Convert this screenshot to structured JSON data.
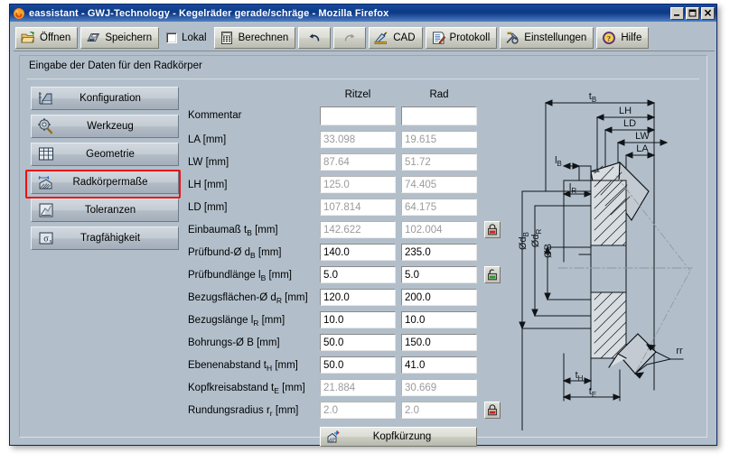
{
  "window": {
    "title": "eassistant - GWJ-Technology - Kegelräder gerade/schräge - Mozilla Firefox",
    "app_icon": "firefox-icon",
    "minimize": "_",
    "maximize": "❐",
    "close": "✕"
  },
  "toolbar": {
    "items": [
      {
        "label": "Öffnen",
        "icon": "open-folder-icon",
        "disabled": false
      },
      {
        "label": "Speichern",
        "icon": "floppy-disk-icon",
        "disabled": false
      },
      {
        "label": "Berechnen",
        "icon": "calculator-icon",
        "disabled": false
      },
      {
        "label": "",
        "icon": "undo-arrow-icon",
        "disabled": false
      },
      {
        "label": "",
        "icon": "redo-arrow-icon",
        "disabled": true
      },
      {
        "label": "CAD",
        "icon": "cad-ruler-icon",
        "disabled": false
      },
      {
        "label": "Protokoll",
        "icon": "report-icon",
        "disabled": false
      },
      {
        "label": "Einstellungen",
        "icon": "settings-tools-icon",
        "disabled": false
      },
      {
        "label": "Hilfe",
        "icon": "help-book-icon",
        "disabled": false
      }
    ],
    "lokal_checkbox": {
      "label": "Lokal",
      "checked": false
    }
  },
  "section": {
    "title": "Eingabe der Daten für den Radkörper"
  },
  "sidebar": {
    "items": [
      {
        "label": "Konfiguration",
        "icon": "configuration-icon",
        "selected": false
      },
      {
        "label": "Werkzeug",
        "icon": "tool-gear-icon",
        "selected": false
      },
      {
        "label": "Geometrie",
        "icon": "geometry-grid-icon",
        "selected": false
      },
      {
        "label": "Radkörpermaße",
        "icon": "wheel-body-icon",
        "selected": true
      },
      {
        "label": "Toleranzen",
        "icon": "tolerances-icon",
        "selected": false
      },
      {
        "label": "Tragfähigkeit",
        "icon": "load-capacity-icon",
        "selected": false
      }
    ]
  },
  "form": {
    "columns": [
      "Ritzel",
      "Rad"
    ],
    "rows": [
      {
        "label": "Kommentar",
        "sub": "",
        "unit": "",
        "ritzel": "",
        "rad": "",
        "readonly": false,
        "tall": true,
        "lock": null
      },
      {
        "label": "LA",
        "sub": "",
        "unit": "[mm]",
        "ritzel": "33.098",
        "rad": "19.615",
        "readonly": true,
        "tall": false,
        "lock": null
      },
      {
        "label": "LW",
        "sub": "",
        "unit": "[mm]",
        "ritzel": "87.64",
        "rad": "51.72",
        "readonly": true,
        "tall": false,
        "lock": null
      },
      {
        "label": "LH",
        "sub": "",
        "unit": "[mm]",
        "ritzel": "125.0",
        "rad": "74.405",
        "readonly": true,
        "tall": false,
        "lock": null
      },
      {
        "label": "LD",
        "sub": "",
        "unit": "[mm]",
        "ritzel": "107.814",
        "rad": "64.175",
        "readonly": true,
        "tall": false,
        "lock": null
      },
      {
        "label": "Einbaumaß t",
        "sub": "B",
        "unit": "[mm]",
        "ritzel": "142.622",
        "rad": "102.004",
        "readonly": true,
        "tall": false,
        "lock": "locked-red"
      },
      {
        "label": "Prüfbund-Ø d",
        "sub": "B",
        "unit": "[mm]",
        "ritzel": "140.0",
        "rad": "235.0",
        "readonly": false,
        "tall": false,
        "lock": null
      },
      {
        "label": "Prüfbundlänge l",
        "sub": "B",
        "unit": "[mm]",
        "ritzel": "5.0",
        "rad": "5.0",
        "readonly": false,
        "tall": false,
        "lock": "unlocked-green"
      },
      {
        "label": "Bezugsflächen-Ø d",
        "sub": "R",
        "unit": "[mm]",
        "ritzel": "120.0",
        "rad": "200.0",
        "readonly": false,
        "tall": false,
        "lock": null
      },
      {
        "label": "Bezugslänge l",
        "sub": "R",
        "unit": "[mm]",
        "ritzel": "10.0",
        "rad": "10.0",
        "readonly": false,
        "tall": false,
        "lock": null
      },
      {
        "label": "Bohrungs-Ø B",
        "sub": "",
        "unit": "[mm]",
        "ritzel": "50.0",
        "rad": "150.0",
        "readonly": false,
        "tall": false,
        "lock": null
      },
      {
        "label": "Ebenenabstand t",
        "sub": "H",
        "unit": "[mm]",
        "ritzel": "50.0",
        "rad": "41.0",
        "readonly": false,
        "tall": false,
        "lock": null
      },
      {
        "label": "Kopfkreisabstand t",
        "sub": "E",
        "unit": "[mm]",
        "ritzel": "21.884",
        "rad": "30.669",
        "readonly": true,
        "tall": false,
        "lock": null
      },
      {
        "label": "Rundungsradius r",
        "sub": "r",
        "unit": "[mm]",
        "ritzel": "2.0",
        "rad": "2.0",
        "readonly": true,
        "tall": false,
        "lock": "locked-red"
      }
    ],
    "action_button": {
      "label": "Kopfkürzung",
      "icon": "tip-shortening-icon"
    }
  },
  "drawing": {
    "name": "bevel-gear-wheel-body-section-drawing",
    "dimension_labels": [
      "t_B",
      "LH",
      "LD",
      "LW",
      "LA",
      "l_B",
      "l_R",
      "Ød_B",
      "Ød_R",
      "ØB",
      "t_H",
      "t_E",
      "rr"
    ],
    "labels": {
      "tB": "t",
      "tB_sub": "B",
      "LH": "LH",
      "LD": "LD",
      "LW": "LW",
      "LA": "LA",
      "lB": "l",
      "lB_sub": "B",
      "lR": "l",
      "lR_sub": "R",
      "dB": "Ød",
      "dB_sub": "B",
      "dR": "Ød",
      "dR_sub": "R",
      "B": "ØB",
      "tH": "t",
      "tH_sub": "H",
      "tE": "t",
      "tE_sub": "E",
      "rr": "rr"
    }
  },
  "annotation": {
    "highlight": "red-rectangle-around-radkoerpermasse"
  },
  "colors": {
    "window_bg": "#b2bfcb",
    "titlebar": "#0b3a85",
    "accent_red": "#ee1111",
    "lock_red": "#d22020",
    "lock_green": "#2a9a2a",
    "readonly_text": "#9b9b9b"
  }
}
